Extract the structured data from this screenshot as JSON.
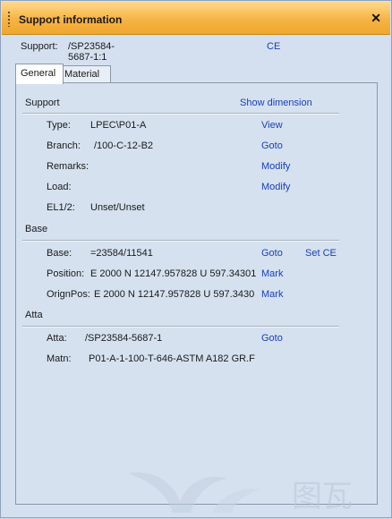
{
  "window": {
    "title": "Support information"
  },
  "top": {
    "support_label": "Support:",
    "support_value": "/SP23584-5687-1:1",
    "ce_link": "CE"
  },
  "tabs": [
    {
      "label": "General"
    },
    {
      "label": "Material"
    }
  ],
  "support": {
    "header": "Support",
    "show_dimension": "Show dimension",
    "rows": [
      {
        "label": "Type:",
        "value": "LPEC\\P01-A",
        "action": "View"
      },
      {
        "label": "Branch:",
        "value": "/100-C-12-B2",
        "action": "Goto"
      },
      {
        "label": "Remarks:",
        "value": "",
        "action": "Modify"
      },
      {
        "label": "Load:",
        "value": "",
        "action": "Modify"
      },
      {
        "label": "EL1/2:",
        "value": "Unset/Unset",
        "action": ""
      }
    ]
  },
  "base": {
    "header": "Base",
    "rows": [
      {
        "label": "Base:",
        "value": "=23584/11541",
        "action": "Goto",
        "action2": "Set CE"
      },
      {
        "label": "Position:",
        "value": "E 2000 N 12147.957828 U 597.34301",
        "action": "Mark"
      },
      {
        "label": "OrignPos:",
        "value": "E 2000 N 12147.957828 U 597.3430",
        "action": "Mark"
      }
    ]
  },
  "atta": {
    "header": "Atta",
    "rows": [
      {
        "label": "Atta:",
        "value": "/SP23584-5687-1",
        "action": "Goto"
      },
      {
        "label": "Matn:",
        "value": "P01-A-1-100-T-646-ASTM A182 GR.F",
        "action": ""
      }
    ]
  },
  "watermark": {
    "text": "图瓦"
  }
}
